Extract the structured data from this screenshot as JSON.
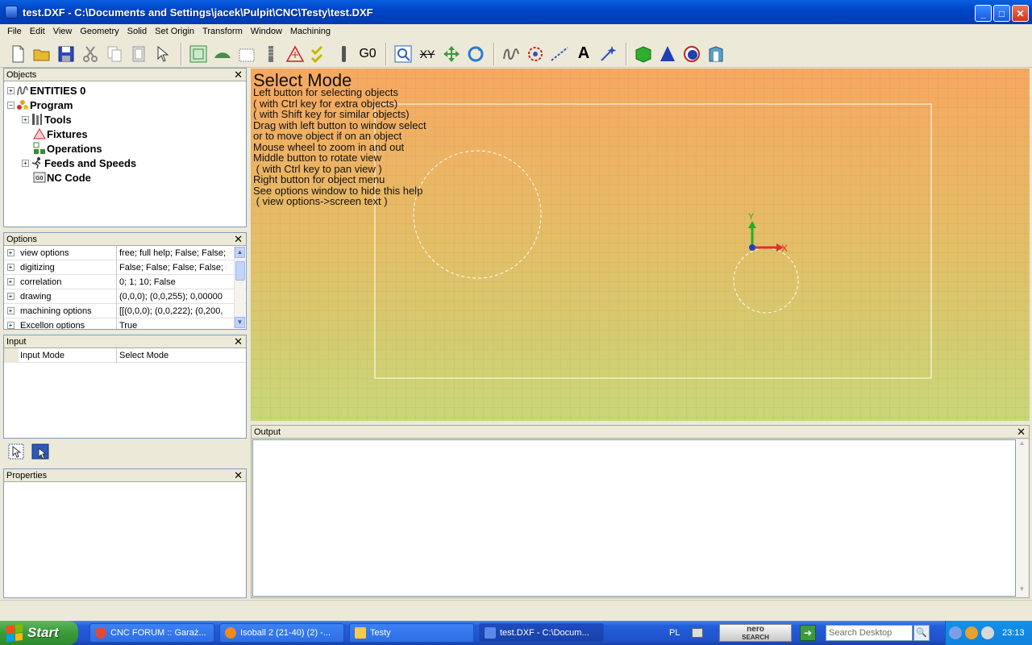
{
  "window": {
    "title": "test.DXF - C:\\Documents and Settings\\jacek\\Pulpit\\CNC\\Testy\\test.DXF",
    "min_label": "_",
    "max_label": "□",
    "close_label": "✕"
  },
  "menu": [
    "File",
    "Edit",
    "View",
    "Geometry",
    "Solid",
    "Set Origin",
    "Transform",
    "Window",
    "Machining"
  ],
  "objects_panel": {
    "title": "Objects",
    "close": "✕",
    "tree": [
      {
        "label": "ENTITIES 0",
        "expander": "+"
      },
      {
        "label": "Program",
        "expander": "−"
      },
      {
        "label": "Tools",
        "expander": "+"
      },
      {
        "label": "Fixtures",
        "expander": ""
      },
      {
        "label": "Operations",
        "expander": ""
      },
      {
        "label": "Feeds and Speeds",
        "expander": "+"
      },
      {
        "label": "NC Code",
        "expander": ""
      }
    ]
  },
  "options_panel": {
    "title": "Options",
    "close": "✕",
    "rows": [
      {
        "name": "view options",
        "value": "free; full help; False; False;"
      },
      {
        "name": "digitizing",
        "value": "False; False; False; False; F"
      },
      {
        "name": "correlation",
        "value": "0; 1; 10; False"
      },
      {
        "name": "drawing",
        "value": "(0,0,0); (0,0,255); 0,00000"
      },
      {
        "name": "machining options",
        "value": "[[(0,0,0); (0,0,222); (0,200,"
      },
      {
        "name": "Excellon options",
        "value": "True"
      }
    ]
  },
  "input_panel": {
    "title": "Input",
    "close": "✕",
    "row": {
      "name": "Input Mode",
      "value": "Select Mode"
    }
  },
  "properties_panel": {
    "title": "Properties",
    "close": "✕"
  },
  "output_panel": {
    "title": "Output",
    "close": "✕"
  },
  "viewport": {
    "help_title": "Select Mode",
    "help_lines": [
      "Left button for selecting objects",
      "( with Ctrl key for extra objects)",
      "( with Shift key for similar objects)",
      "Drag with left button to window select",
      "or to move object if on an object",
      "Mouse wheel to zoom in and out",
      "Middle button to rotate view",
      " ( with Ctrl key to pan view )",
      "Right button for object menu",
      "See options window to hide this help",
      " ( view options->screen text )"
    ],
    "axis_x": "X",
    "axis_y": "Y"
  },
  "toolbar": {
    "g0_label": "G0",
    "text_label": "A",
    "xy_label": "XY"
  },
  "taskbar": {
    "start": "Start",
    "tasks": [
      {
        "label": "CNC FORUM :: Garaż...",
        "color": "#e04a3a"
      },
      {
        "label": "Isoball 2 (21-40) (2) -...",
        "color": "#f08a1a"
      },
      {
        "label": "Testy",
        "color": "#f4cc4a"
      },
      {
        "label": "test.DXF - C:\\Docum...",
        "color": "#5a8ae8"
      }
    ],
    "lang": "PL",
    "nero_top": "nero",
    "nero_bottom": "SEARCH",
    "search_placeholder": "Search Desktop",
    "clock": "23:13"
  }
}
